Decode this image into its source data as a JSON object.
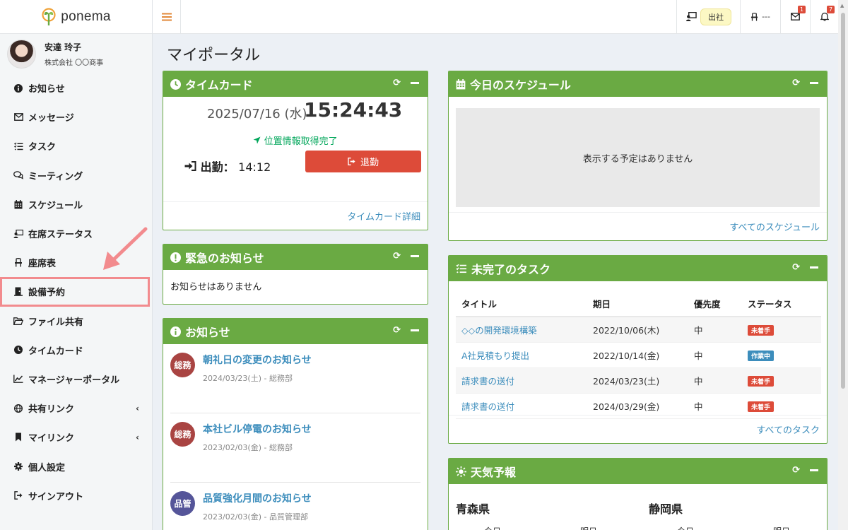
{
  "brand": {
    "name": "ponema"
  },
  "user": {
    "name": "安達 玲子",
    "company": "株式会社 〇〇商事"
  },
  "sidebar": {
    "items": [
      {
        "label": "お知らせ",
        "icon": "info-icon"
      },
      {
        "label": "メッセージ",
        "icon": "envelope-icon"
      },
      {
        "label": "タスク",
        "icon": "tasks-icon"
      },
      {
        "label": "ミーティング",
        "icon": "comments-icon"
      },
      {
        "label": "スケジュール",
        "icon": "calendar-icon"
      },
      {
        "label": "在席ステータス",
        "icon": "presence-icon"
      },
      {
        "label": "座席表",
        "icon": "chair-icon"
      },
      {
        "label": "設備予約",
        "icon": "door-icon"
      },
      {
        "label": "ファイル共有",
        "icon": "folder-icon"
      },
      {
        "label": "タイムカード",
        "icon": "clock-icon"
      },
      {
        "label": "マネージャーポータル",
        "icon": "chart-icon"
      },
      {
        "label": "共有リンク",
        "icon": "globe-icon"
      },
      {
        "label": "マイリンク",
        "icon": "bookmark-icon"
      },
      {
        "label": "個人設定",
        "icon": "gear-icon"
      },
      {
        "label": "サインアウト",
        "icon": "sign-out-icon"
      }
    ]
  },
  "header": {
    "status": "出社",
    "seat": "---",
    "mail_count": "1",
    "notify_count": "7"
  },
  "page": {
    "title": "マイポータル"
  },
  "timecard": {
    "title": "タイムカード",
    "date": "2025/07/16 (水)",
    "time": "15:24:43",
    "gps": "位置情報取得完了",
    "clock_in_label": "出勤：",
    "clock_in_time": "14:12",
    "clock_out_button": "退勤",
    "footer_link": "タイムカード詳細"
  },
  "urgent": {
    "title": "緊急のお知らせ",
    "body": "お知らせはありません"
  },
  "notices": {
    "title": "お知らせ",
    "items": [
      {
        "badge": "総務",
        "title": "朝礼日の変更のお知らせ",
        "meta": "2024/03/23(土) - 総務部"
      },
      {
        "badge": "総務",
        "title": "本社ビル停電のお知らせ",
        "meta": "2023/02/03(金) - 総務部"
      },
      {
        "badge": "品管",
        "title": "品質強化月間のお知らせ",
        "meta": "2023/02/03(金) - 品質管理部"
      }
    ]
  },
  "schedule": {
    "title": "今日のスケジュール",
    "empty": "表示する予定はありません",
    "footer_link": "すべてのスケジュール"
  },
  "tasks": {
    "title": "未完了のタスク",
    "columns": [
      "タイトル",
      "期日",
      "優先度",
      "ステータス"
    ],
    "rows": [
      {
        "title": "◇◇の開発環境構築",
        "due": "2022/10/06(木)",
        "priority": "中",
        "status": "未着手"
      },
      {
        "title": "A社見積もり提出",
        "due": "2022/10/14(金)",
        "priority": "中",
        "status": "作業中"
      },
      {
        "title": "請求書の送付",
        "due": "2024/03/23(土)",
        "priority": "中",
        "status": "未着手"
      },
      {
        "title": "請求書の送付",
        "due": "2024/03/29(金)",
        "priority": "中",
        "status": "未着手"
      }
    ],
    "footer_link": "すべてのタスク"
  },
  "weather": {
    "title": "天気予報",
    "prefs": [
      {
        "name": "青森県",
        "days": [
          "今日",
          "明日"
        ]
      },
      {
        "name": "静岡県",
        "days": [
          "今日",
          "明日"
        ]
      }
    ]
  },
  "colors": {
    "accent": "#6aaa43",
    "danger": "#dd4b39",
    "link": "#3c8dbc",
    "status_todo": "#dd4b39",
    "status_doing": "#3c8dbc",
    "badge_soumu": "#a94442",
    "badge_hinkan": "#555599"
  }
}
